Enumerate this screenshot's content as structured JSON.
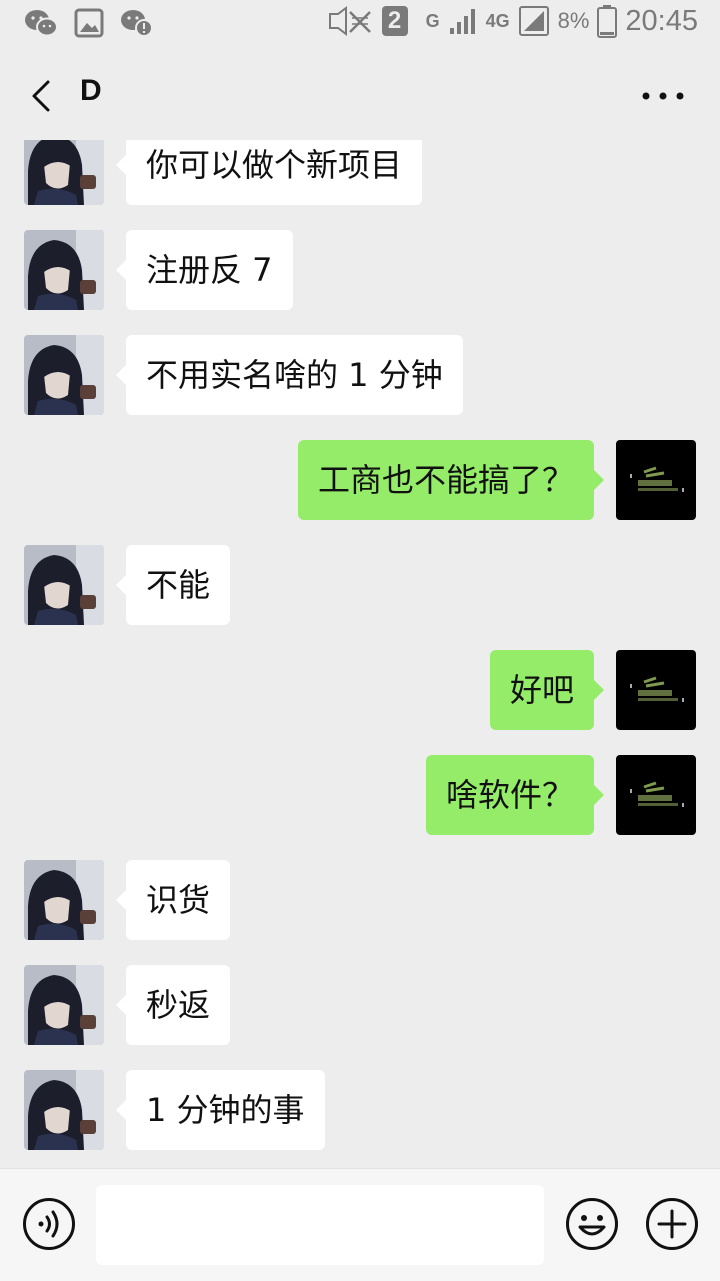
{
  "status_bar": {
    "sim_slot": "2",
    "network_g": "G",
    "network_4g": "4G",
    "battery_percent": "8%",
    "time": "20:45"
  },
  "header": {
    "title": "D"
  },
  "messages": [
    {
      "side": "in",
      "text": "你可以做个新项目"
    },
    {
      "side": "in",
      "text": "注册反 7"
    },
    {
      "side": "in",
      "text": "不用实名啥的 1 分钟"
    },
    {
      "side": "out",
      "text": "工商也不能搞了？"
    },
    {
      "side": "in",
      "text": "不能"
    },
    {
      "side": "out",
      "text": "好吧"
    },
    {
      "side": "out",
      "text": "啥软件？"
    },
    {
      "side": "in",
      "text": "识货"
    },
    {
      "side": "in",
      "text": "秒返"
    },
    {
      "side": "in",
      "text": "1 分钟的事"
    }
  ],
  "input": {
    "value": ""
  },
  "colors": {
    "background": "#ededed",
    "incoming_bubble": "#ffffff",
    "outgoing_bubble": "#95ec69"
  },
  "icons": [
    "wechat-icon",
    "gallery-icon",
    "wechat-alert-icon",
    "mute-icon",
    "signal-icon",
    "battery-icon",
    "back-icon",
    "more-icon",
    "voice-icon",
    "emoji-icon",
    "plus-icon"
  ]
}
